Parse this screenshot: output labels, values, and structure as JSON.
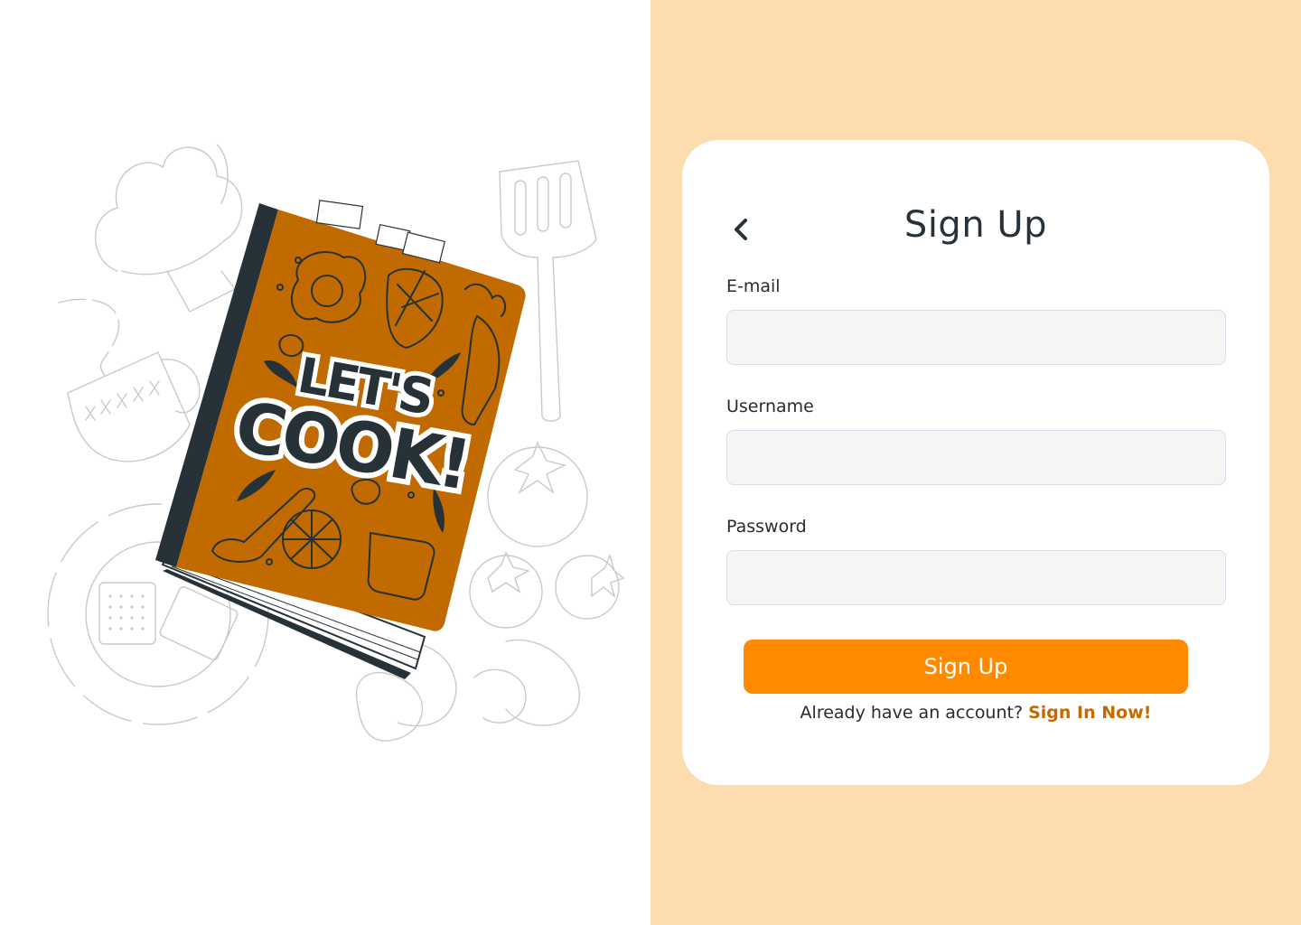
{
  "colors": {
    "panel_bg": "#FDDCB0",
    "card_bg": "#FFFFFF",
    "accent": "#FF8A00",
    "link": "#C46A00",
    "book_cover": "#C06A00",
    "book_spine": "#263238",
    "input_bg": "#F5F5F6",
    "text_dark": "#263238"
  },
  "illustration": {
    "cover_line1": "LET'S",
    "cover_line2": "COOK!"
  },
  "form": {
    "back_icon": "chevron-left-icon",
    "title": "Sign Up",
    "email_label": "E-mail",
    "email_value": "",
    "username_label": "Username",
    "username_value": "",
    "password_label": "Password",
    "password_value": "",
    "submit_label": "Sign Up",
    "signin_prompt": "Already have an account?",
    "signin_link": "Sign In Now!"
  }
}
